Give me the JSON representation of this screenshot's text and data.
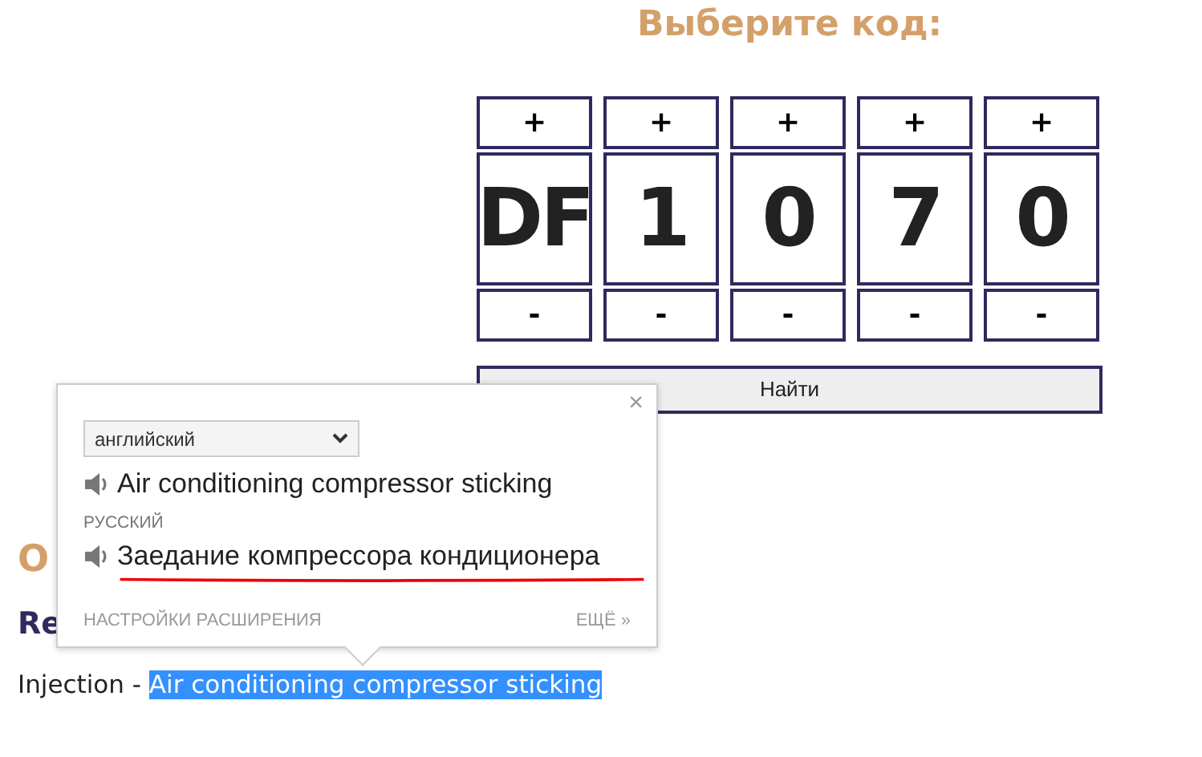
{
  "heading": "Выберите код:",
  "code_columns": [
    {
      "plus": "+",
      "value": "DF",
      "minus": "-"
    },
    {
      "plus": "+",
      "value": "1",
      "minus": "-"
    },
    {
      "plus": "+",
      "value": "0",
      "minus": "-"
    },
    {
      "plus": "+",
      "value": "7",
      "minus": "-"
    },
    {
      "plus": "+",
      "value": "0",
      "minus": "-"
    }
  ],
  "search_button": "Найти",
  "section_heading": "O",
  "subheading": "Re",
  "paragraph": {
    "prefix": "Injection - ",
    "highlighted": "Air conditioning compressor sticking"
  },
  "translate_popup": {
    "close": "×",
    "source_language": "английский",
    "source_text": "Air conditioning compressor sticking",
    "target_language": "РУССКИЙ",
    "target_text": "Заедание компрессора кондиционера",
    "target_underlined": true,
    "settings_link": "НАСТРОЙКИ РАСШИРЕНИЯ",
    "more_link": "ЕЩЁ »"
  }
}
